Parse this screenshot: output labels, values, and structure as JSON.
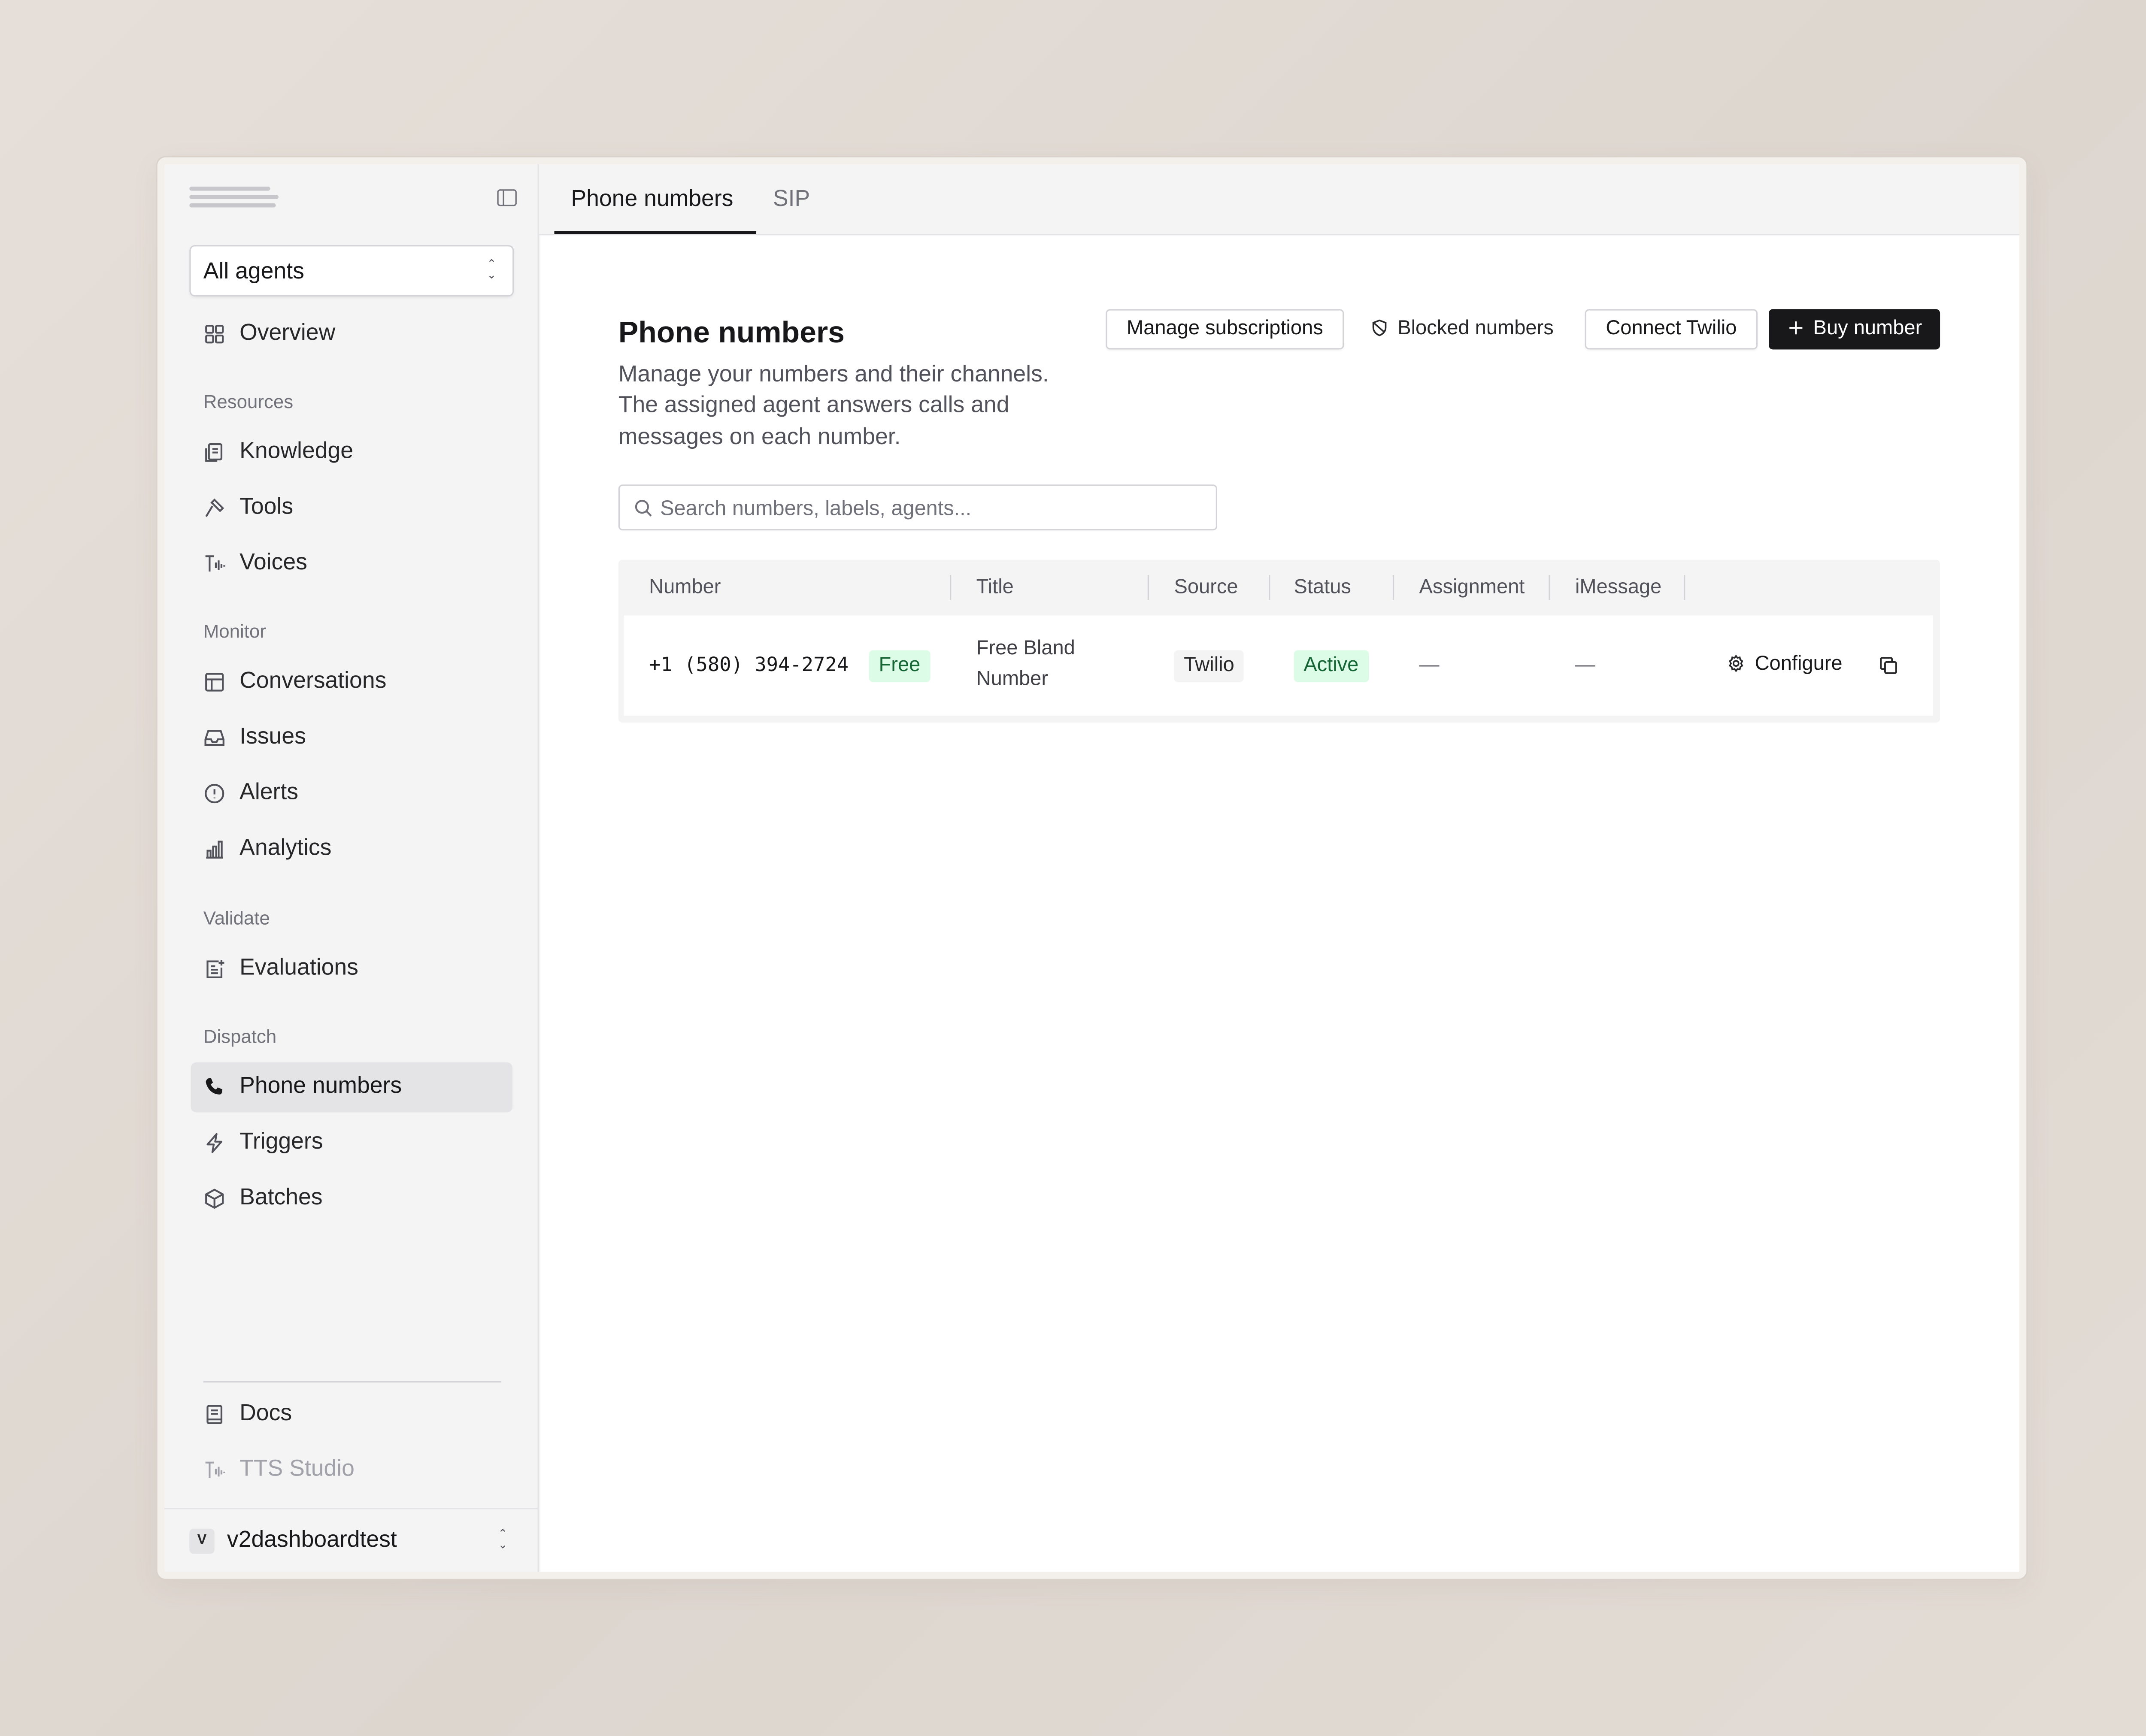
{
  "sidebar": {
    "agent_selector": {
      "value": "All agents"
    },
    "overview": "Overview",
    "sections": {
      "resources": "Resources",
      "monitor": "Monitor",
      "validate": "Validate",
      "dispatch": "Dispatch"
    },
    "items": {
      "knowledge": "Knowledge",
      "tools": "Tools",
      "voices": "Voices",
      "conversations": "Conversations",
      "issues": "Issues",
      "alerts": "Alerts",
      "analytics": "Analytics",
      "evaluations": "Evaluations",
      "phone_numbers": "Phone numbers",
      "triggers": "Triggers",
      "batches": "Batches"
    },
    "footer": {
      "docs": "Docs",
      "tts_studio": "TTS Studio"
    },
    "account": {
      "initial": "V",
      "name": "v2dashboardtest"
    },
    "active_item": "Phone numbers"
  },
  "tabs": {
    "phone_numbers": "Phone numbers",
    "sip": "SIP",
    "active": "Phone numbers"
  },
  "page": {
    "title": "Phone numbers",
    "description": "Manage your numbers and their channels. The assigned agent answers calls and messages on each number.",
    "buttons": {
      "manage_subscriptions": "Manage subscriptions",
      "blocked_numbers": "Blocked numbers",
      "connect_twilio": "Connect Twilio",
      "buy_number": "Buy number"
    },
    "search": {
      "placeholder": "Search numbers, labels, agents...",
      "value": ""
    }
  },
  "table": {
    "columns": {
      "number": "Number",
      "title": "Title",
      "source": "Source",
      "status": "Status",
      "assignment": "Assignment",
      "imessage": "iMessage"
    },
    "rows": [
      {
        "number": "+1 (580) 394-2724",
        "plan_badge": "Free",
        "title_line1": "Free Bland",
        "title_line2": "Number",
        "source": "Twilio",
        "status": "Active",
        "assignment": "—",
        "imessage": "—",
        "configure_label": "Configure"
      }
    ]
  },
  "colors": {
    "accent_dark": "#18181b",
    "status_active_bg": "#dcfce7",
    "status_active_text": "#166534",
    "sidebar_bg": "#f4f4f5"
  },
  "icons": {
    "collapse": "sidebar-collapse-icon",
    "overview": "grid-icon",
    "knowledge": "document-icon",
    "tools": "hammer-icon",
    "voices": "audio-waveform-icon",
    "conversations": "table-icon",
    "issues": "inbox-icon",
    "alerts": "alert-circle-icon",
    "analytics": "bar-chart-icon",
    "evaluations": "clipboard-icon",
    "phone_numbers": "phone-icon",
    "triggers": "lightning-icon",
    "batches": "package-icon",
    "docs": "book-icon",
    "blocked": "blocked-icon",
    "plus": "plus-icon",
    "search": "search-icon",
    "configure": "gear-icon",
    "copy": "copy-icon"
  }
}
